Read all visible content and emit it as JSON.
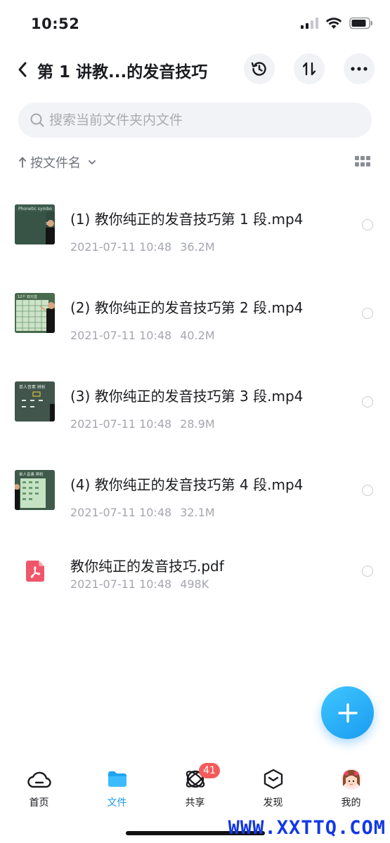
{
  "status_bar": {
    "time": "10:52"
  },
  "header": {
    "title": "第 1 讲教...的发音技巧"
  },
  "search": {
    "placeholder": "搜索当前文件夹内文件"
  },
  "sort": {
    "label": "按文件名"
  },
  "files": [
    {
      "name": "(1) 教你纯正的发音技巧第 1 段.mp4",
      "date": "2021-07-11 10:48",
      "size": "36.2M",
      "type": "video"
    },
    {
      "name": "(2) 教你纯正的发音技巧第 2 段.mp4",
      "date": "2021-07-11 10:48",
      "size": "40.2M",
      "type": "video"
    },
    {
      "name": "(3) 教你纯正的发音技巧第 3 段.mp4",
      "date": "2021-07-11 10:48",
      "size": "28.9M",
      "type": "video"
    },
    {
      "name": "(4) 教你纯正的发音技巧第 4 段.mp4",
      "date": "2021-07-11 10:48",
      "size": "32.1M",
      "type": "video"
    },
    {
      "name": "教你纯正的发音技巧.pdf",
      "date": "2021-07-11 10:48",
      "size": "498K",
      "type": "pdf"
    }
  ],
  "tabs": [
    {
      "label": "首页",
      "active": false
    },
    {
      "label": "文件",
      "active": true
    },
    {
      "label": "共享",
      "active": false,
      "badge": "41"
    },
    {
      "label": "发现",
      "active": false
    },
    {
      "label": "我的",
      "active": false
    }
  ],
  "watermark": "WWW.XXTTQ.COM",
  "colors": {
    "accent": "#1d9bf0",
    "badge": "#f55b5b",
    "pdf": "#f0566a"
  }
}
